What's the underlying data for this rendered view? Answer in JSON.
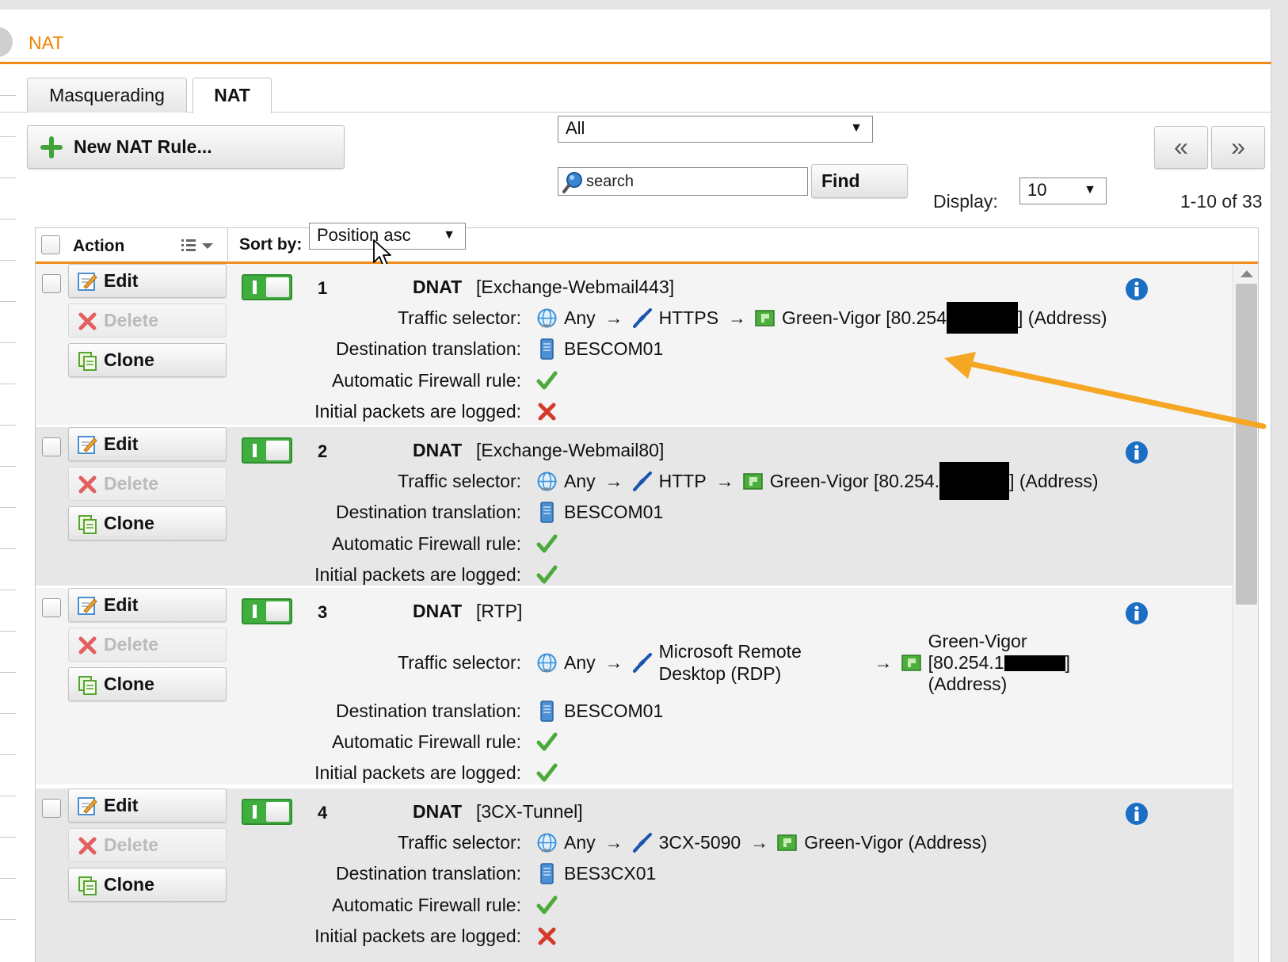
{
  "header": {
    "title": "NAT"
  },
  "tabs": [
    {
      "label": "Masquerading",
      "active": false
    },
    {
      "label": "NAT",
      "active": true
    }
  ],
  "toolbar": {
    "new_rule_label": "New NAT Rule...",
    "filter_value": "All",
    "search_placeholder": "search",
    "find_label": "Find",
    "display_label": "Display:",
    "display_value": "10",
    "count_text": "1-10 of 33",
    "prev_label": "«",
    "next_label": "»"
  },
  "table": {
    "action_header": "Action",
    "sort_label": "Sort by:",
    "sort_value": "Position asc",
    "labels": {
      "traffic": "Traffic selector:",
      "dest": "Destination translation:",
      "firewall": "Automatic Firewall rule:",
      "logged": "Initial packets are logged:"
    },
    "buttons": {
      "edit": "Edit",
      "delete": "Delete",
      "clone": "Clone"
    }
  },
  "common": {
    "any": "Any",
    "arrow": "→"
  },
  "rules": [
    {
      "num": "1",
      "type": "DNAT",
      "name": "[Exchange-Webmail443]",
      "service": "HTTPS",
      "target_prefix": "Green-Vigor [80.254",
      "target_suffix": "] (Address)",
      "dest": "BESCOM01",
      "firewall": true,
      "logged": false
    },
    {
      "num": "2",
      "type": "DNAT",
      "name": "[Exchange-Webmail80]",
      "service": "HTTP",
      "target_prefix": "Green-Vigor [80.254.",
      "target_suffix": "] (Address)",
      "dest": "BESCOM01",
      "firewall": true,
      "logged": true
    },
    {
      "num": "3",
      "type": "DNAT",
      "name": "[RTP]",
      "service_line1": "Microsoft Remote",
      "service_line2": "Desktop (RDP)",
      "target_line1": "Green-Vigor",
      "target_line2_prefix": "[80.254.1",
      "target_line2_suffix": "]",
      "target_line3": "(Address)",
      "dest": "BESCOM01",
      "firewall": true,
      "logged": true
    },
    {
      "num": "4",
      "type": "DNAT",
      "name": "[3CX-Tunnel]",
      "service": "3CX-5090",
      "target": "Green-Vigor (Address)",
      "dest": "BES3CX01",
      "firewall": true,
      "logged": false
    }
  ],
  "colors": {
    "accent": "#f28b1a",
    "enabled": "#3fae3f",
    "info": "#1a6fc4",
    "annotation": "#f5a623"
  }
}
